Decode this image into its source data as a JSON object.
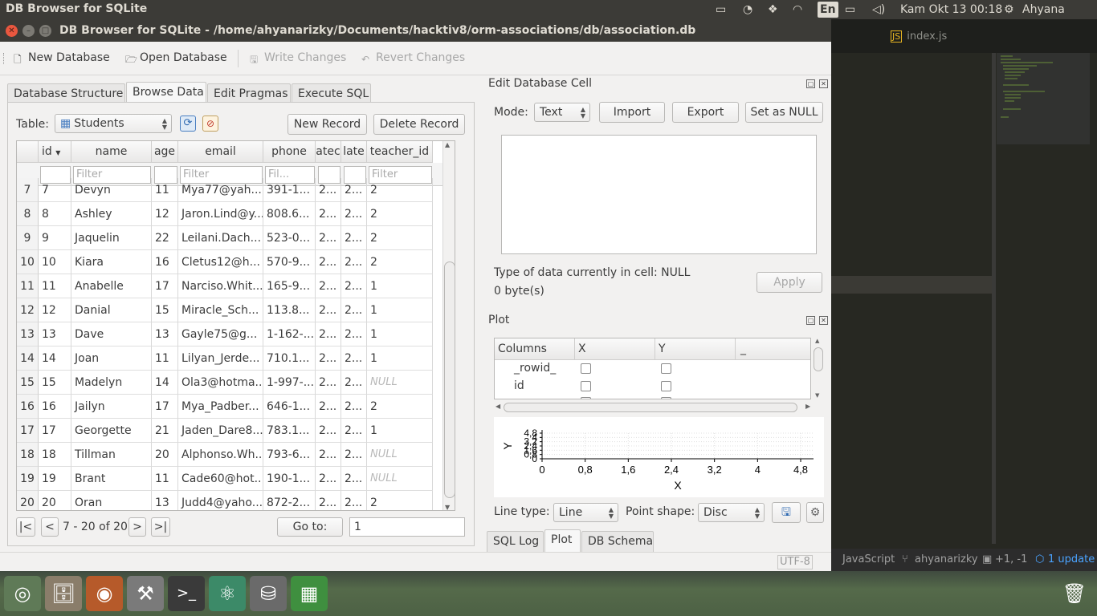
{
  "top_panel": {
    "app_name": "DB Browser for SQLite",
    "language": "En",
    "clock": "Kam Okt 13 00:18",
    "user": "Ahyana Rizky"
  },
  "editor": {
    "tab": "index.js",
    "status_language": "JavaScript",
    "status_user": "ahyanarizky",
    "status_diff": "+1, -1",
    "status_update": "1 update"
  },
  "window": {
    "title": "DB Browser for SQLite - /home/ahyanarizky/Documents/hacktiv8/orm-associations/db/association.db"
  },
  "toolbar": {
    "new_db": "New Database",
    "open_db": "Open Database",
    "write": "Write Changes",
    "revert": "Revert Changes"
  },
  "tabs": [
    "Database Structure",
    "Browse Data",
    "Edit Pragmas",
    "Execute SQL"
  ],
  "browse": {
    "table_label": "Table:",
    "table_value": "Students",
    "new_record": "New Record",
    "delete_record": "Delete Record",
    "columns": [
      "id",
      "name",
      "age",
      "email",
      "phone",
      "atec",
      "late",
      "teacher_id"
    ],
    "filters": [
      "",
      "Filter",
      "",
      "Filter",
      "Fil...",
      "",
      "",
      "Filter"
    ],
    "rows": [
      {
        "rn": "7",
        "id": "7",
        "name": "Devyn",
        "age": "11",
        "email": "Mya77@yah...",
        "phone": "391-1...",
        "a": "2...",
        "b": "2...",
        "t": "2"
      },
      {
        "rn": "8",
        "id": "8",
        "name": "Ashley",
        "age": "12",
        "email": "Jaron.Lind@y...",
        "phone": "808.6...",
        "a": "2...",
        "b": "2...",
        "t": "2"
      },
      {
        "rn": "9",
        "id": "9",
        "name": "Jaquelin",
        "age": "22",
        "email": "Leilani.Dach...",
        "phone": "523-0...",
        "a": "2...",
        "b": "2...",
        "t": "2"
      },
      {
        "rn": "10",
        "id": "10",
        "name": "Kiara",
        "age": "16",
        "email": "Cletus12@h...",
        "phone": "570-9...",
        "a": "2...",
        "b": "2...",
        "t": "2"
      },
      {
        "rn": "11",
        "id": "11",
        "name": "Anabelle",
        "age": "17",
        "email": "Narciso.Whit...",
        "phone": "165-9...",
        "a": "2...",
        "b": "2...",
        "t": "1"
      },
      {
        "rn": "12",
        "id": "12",
        "name": "Danial",
        "age": "15",
        "email": "Miracle_Sch...",
        "phone": "113.8...",
        "a": "2...",
        "b": "2...",
        "t": "1"
      },
      {
        "rn": "13",
        "id": "13",
        "name": "Dave",
        "age": "13",
        "email": "Gayle75@g...",
        "phone": "1-162-...",
        "a": "2...",
        "b": "2...",
        "t": "1"
      },
      {
        "rn": "14",
        "id": "14",
        "name": "Joan",
        "age": "11",
        "email": "Lilyan_Jerde...",
        "phone": "710.1...",
        "a": "2...",
        "b": "2...",
        "t": "1"
      },
      {
        "rn": "15",
        "id": "15",
        "name": "Madelyn",
        "age": "14",
        "email": "Ola3@hotma...",
        "phone": "1-997-...",
        "a": "2...",
        "b": "2...",
        "t": "NULL"
      },
      {
        "rn": "16",
        "id": "16",
        "name": "Jailyn",
        "age": "17",
        "email": "Mya_Padber...",
        "phone": "646-1...",
        "a": "2...",
        "b": "2...",
        "t": "2"
      },
      {
        "rn": "17",
        "id": "17",
        "name": "Georgette",
        "age": "21",
        "email": "Jaden_Dare8...",
        "phone": "783.1...",
        "a": "2...",
        "b": "2...",
        "t": "1"
      },
      {
        "rn": "18",
        "id": "18",
        "name": "Tillman",
        "age": "20",
        "email": "Alphonso.Wh...",
        "phone": "793-6...",
        "a": "2...",
        "b": "2...",
        "t": "NULL"
      },
      {
        "rn": "19",
        "id": "19",
        "name": "Brant",
        "age": "11",
        "email": "Cade60@hot...",
        "phone": "190-1...",
        "a": "2...",
        "b": "2...",
        "t": "NULL"
      },
      {
        "rn": "20",
        "id": "20",
        "name": "Oran",
        "age": "13",
        "email": "Judd4@yaho...",
        "phone": "872-2...",
        "a": "2...",
        "b": "2...",
        "t": "2"
      }
    ],
    "nav_first": "|<",
    "nav_prev": "<",
    "range": "7 - 20 of 20",
    "nav_next": ">",
    "nav_last": ">|",
    "goto_label": "Go to:",
    "goto_value": "1"
  },
  "edit_cell": {
    "title": "Edit Database Cell",
    "mode_label": "Mode:",
    "mode_value": "Text",
    "import": "Import",
    "export": "Export",
    "set_null": "Set as NULL",
    "type_info": "Type of data currently in cell: NULL",
    "size_info": "0 byte(s)",
    "apply": "Apply"
  },
  "plot": {
    "title": "Plot",
    "col_headers": [
      "Columns",
      "X",
      "Y",
      "_"
    ],
    "col_rows": [
      "_rowid_",
      "id"
    ],
    "x_ticks": [
      "0",
      "0,8",
      "1,6",
      "2,4",
      "3,2",
      "4",
      "4,8"
    ],
    "y_ticks": [
      "4,8",
      "4",
      "3,2",
      "2,4",
      "1,6",
      "0,8",
      "0"
    ],
    "x_label": "X",
    "y_label": "Y",
    "line_type_label": "Line type:",
    "line_type_value": "Line",
    "point_shape_label": "Point shape:",
    "point_shape_value": "Disc"
  },
  "bottom_tabs": [
    "SQL Log",
    "Plot",
    "DB Schema"
  ],
  "status": {
    "encoding": "UTF-8"
  }
}
